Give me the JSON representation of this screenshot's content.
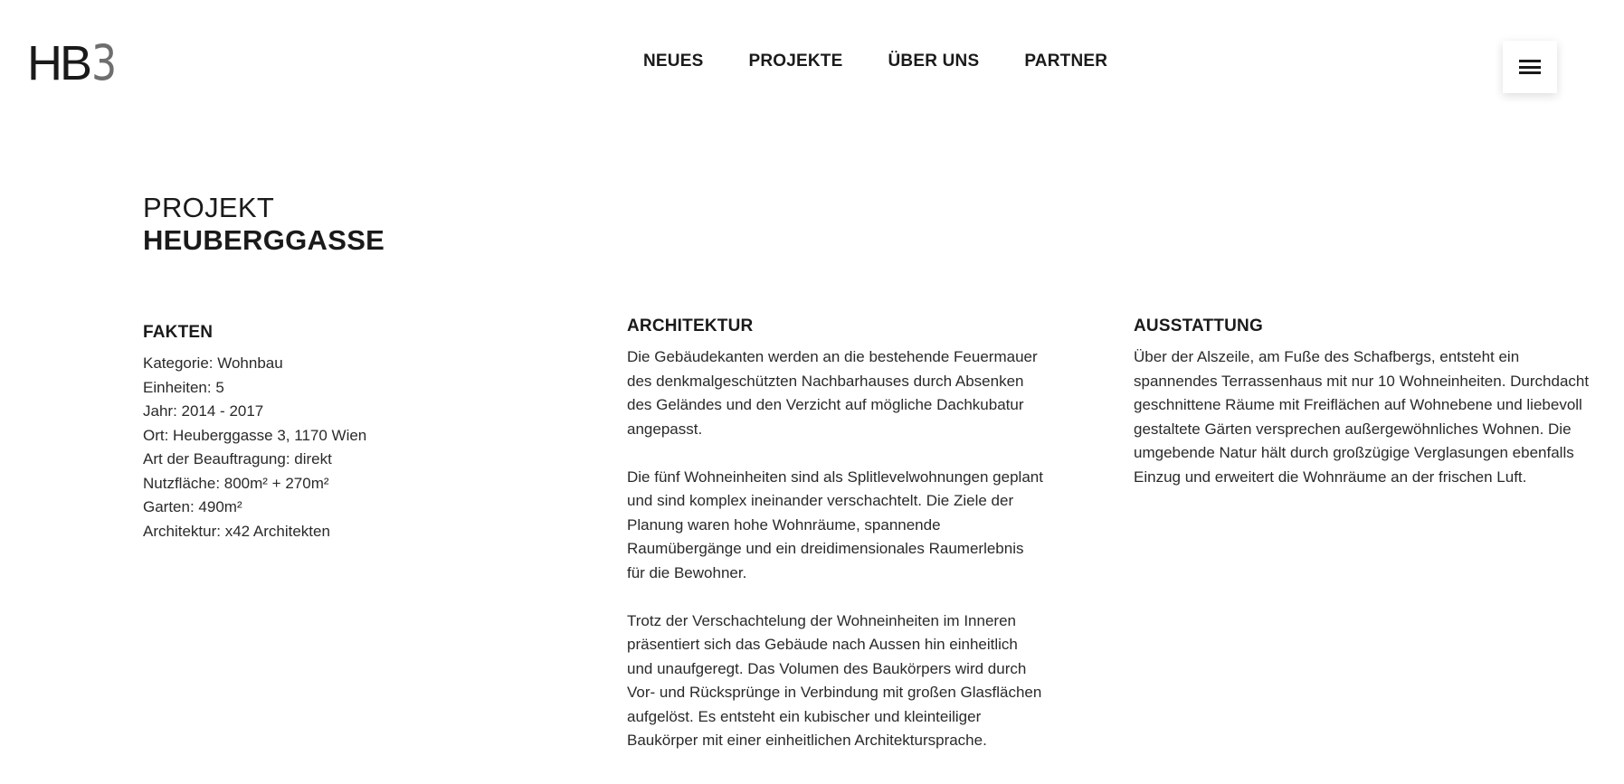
{
  "header": {
    "logo_main": "HB",
    "logo_num": "3",
    "nav": [
      {
        "label": "NEUES"
      },
      {
        "label": "PROJEKTE"
      },
      {
        "label": "ÜBER UNS"
      },
      {
        "label": "PARTNER"
      }
    ],
    "menu_icon": "hamburger-menu-icon"
  },
  "title": {
    "kicker": "PROJEKT",
    "name": "HEUBERGGASSE"
  },
  "fakten": {
    "heading": "FAKTEN",
    "items": [
      "Kategorie: Wohnbau",
      "Einheiten: 5",
      "Jahr: 2014 - 2017",
      "Ort: Heuberggasse 3, 1170 Wien",
      "Art der Beauftragung: direkt",
      "Nutzfläche: 800m² + 270m²",
      "Garten: 490m²",
      "Architektur: x42 Architekten"
    ]
  },
  "architektur": {
    "heading": "ARCHITEKTUR",
    "paragraphs": [
      "Die Gebäudekanten werden an die bestehende Feuermauer des denkmalgeschützten Nachbarhauses durch Absenken des Geländes und den Verzicht auf mögliche Dachkubatur angepasst.",
      "Die fünf Wohneinheiten sind als Splitlevelwohnungen geplant und sind komplex ineinander verschachtelt. Die Ziele der Planung waren hohe Wohnräume, spannende Raumübergänge und ein dreidimensionales Raumerlebnis für die Bewohner.",
      "Trotz der Verschachtelung der Wohneinheiten im Inneren präsentiert sich das Gebäude nach Aussen hin einheitlich und unaufgeregt. Das Volumen des Baukörpers wird durch Vor- und Rücksprünge in Verbindung mit großen Glasflächen aufgelöst. Es entsteht ein kubischer und kleinteiliger Baukörper mit einer einheitlichen Architektursprache."
    ]
  },
  "ausstattung": {
    "heading": "AUSSTATTUNG",
    "paragraphs": [
      "Über der Alszeile, am Fuße des Schafbergs, entsteht ein spannendes Terrassenhaus mit nur 10 Wohneinheiten. Durchdacht geschnittene Räume mit Freiflächen auf Wohnebene und liebevoll gestaltete Gärten versprechen außergewöhnliches Wohnen. Die umgebende Natur hält durch großzügige Verglasungen ebenfalls Einzug und erweitert die Wohnräume an der frischen Luft."
    ]
  }
}
